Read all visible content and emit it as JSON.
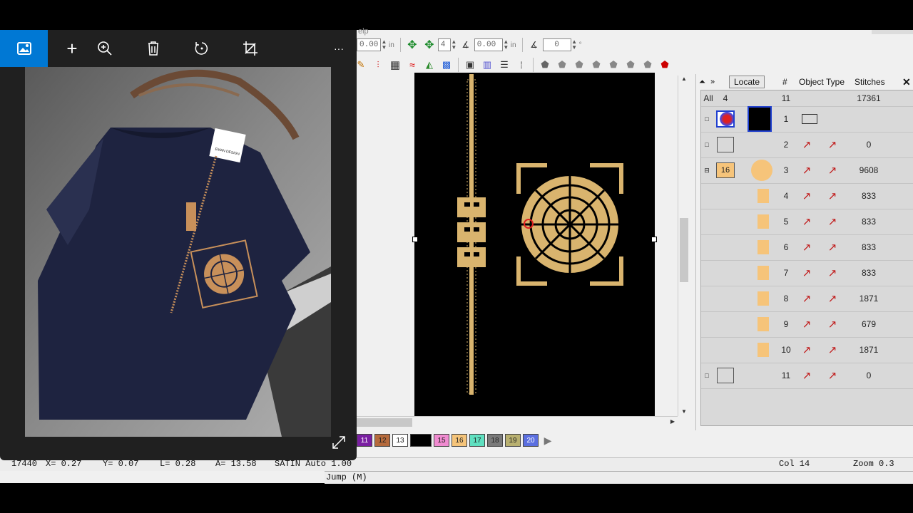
{
  "viewer": {
    "tools": [
      "image-icon",
      "add-icon",
      "zoom-in-icon",
      "delete-icon",
      "rotate-icon",
      "crop-icon",
      "more-icon",
      "expand-icon"
    ],
    "more_label": "···",
    "label_tag_text": "EMAN DESIGN",
    "accent": "#0078d4"
  },
  "app": {
    "menu_partial": "elp",
    "toolbar": {
      "fields": [
        "0.00",
        "4",
        "0.00",
        "0"
      ],
      "units": [
        "in",
        "in",
        "°"
      ]
    },
    "object_panel": {
      "locate_label": "Locate",
      "headers": {
        "num": "#",
        "object": "Object",
        "type": "Type",
        "stitches": "Stitches"
      },
      "summary": {
        "label": "All",
        "count": "4",
        "objects": "11",
        "stitches": "17361"
      },
      "group_badge": "16",
      "rows": [
        {
          "num": "1",
          "stitches": ""
        },
        {
          "num": "2",
          "stitches": "0"
        },
        {
          "num": "3",
          "stitches": "9608"
        },
        {
          "num": "4",
          "stitches": "833"
        },
        {
          "num": "5",
          "stitches": "833"
        },
        {
          "num": "6",
          "stitches": "833"
        },
        {
          "num": "7",
          "stitches": "833"
        },
        {
          "num": "8",
          "stitches": "1871"
        },
        {
          "num": "9",
          "stitches": "679"
        },
        {
          "num": "10",
          "stitches": "1871"
        },
        {
          "num": "11",
          "stitches": "0"
        }
      ]
    },
    "palette": [
      {
        "label": "11",
        "color": "#7a1fa2"
      },
      {
        "label": "12",
        "color": "#b56a3c"
      },
      {
        "label": "13",
        "color": "#ffffff"
      },
      {
        "label": "",
        "color": "#000000"
      },
      {
        "label": "15",
        "color": "#f08bd0"
      },
      {
        "label": "16",
        "color": "#f5c47a"
      },
      {
        "label": "17",
        "color": "#5fe0c0"
      },
      {
        "label": "18",
        "color": "#7a7a7a"
      },
      {
        "label": "19",
        "color": "#b8b070"
      },
      {
        "label": "20",
        "color": "#5b6fe0"
      }
    ],
    "status": {
      "stitch_count": "17440",
      "x": "X=    0.27",
      "y": "Y=    0.07",
      "l": "L=    0.28",
      "a": "A=   13.58",
      "mode": "SATIN Auto  1.00",
      "col": "Col 14",
      "zoom": "Zoom 0.3",
      "jump": "Jump (M)"
    },
    "design_color": "#d9b46e"
  }
}
